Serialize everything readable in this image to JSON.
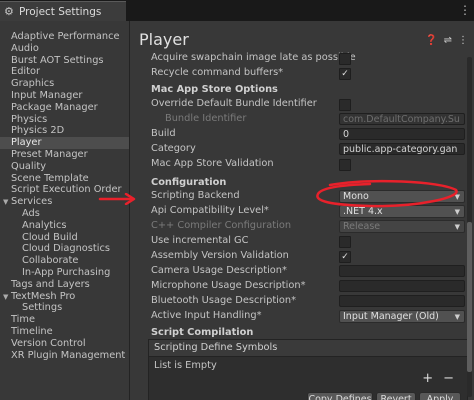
{
  "window": {
    "tab_label": "Project Settings",
    "menu_icon": "kebab-menu-icon"
  },
  "sidebar": {
    "items": [
      {
        "label": "Adaptive Performance",
        "level": 0
      },
      {
        "label": "Audio",
        "level": 0
      },
      {
        "label": "Burst AOT Settings",
        "level": 0
      },
      {
        "label": "Editor",
        "level": 0
      },
      {
        "label": "Graphics",
        "level": 0
      },
      {
        "label": "Input Manager",
        "level": 0
      },
      {
        "label": "Package Manager",
        "level": 0
      },
      {
        "label": "Physics",
        "level": 0
      },
      {
        "label": "Physics 2D",
        "level": 0
      },
      {
        "label": "Player",
        "level": 0,
        "selected": true
      },
      {
        "label": "Preset Manager",
        "level": 0
      },
      {
        "label": "Quality",
        "level": 0
      },
      {
        "label": "Scene Template",
        "level": 0
      },
      {
        "label": "Script Execution Order",
        "level": 0
      },
      {
        "label": "Services",
        "level": 0,
        "expanded": true
      },
      {
        "label": "Ads",
        "level": 1
      },
      {
        "label": "Analytics",
        "level": 1
      },
      {
        "label": "Cloud Build",
        "level": 1
      },
      {
        "label": "Cloud Diagnostics",
        "level": 1
      },
      {
        "label": "Collaborate",
        "level": 1
      },
      {
        "label": "In-App Purchasing",
        "level": 1
      },
      {
        "label": "Tags and Layers",
        "level": 0
      },
      {
        "label": "TextMesh Pro",
        "level": 0,
        "expanded": true
      },
      {
        "label": "Settings",
        "level": 1
      },
      {
        "label": "Time",
        "level": 0
      },
      {
        "label": "Timeline",
        "level": 0
      },
      {
        "label": "Version Control",
        "level": 0
      },
      {
        "label": "XR Plugin Management",
        "level": 0
      }
    ]
  },
  "main": {
    "title": "Player",
    "header_icons": [
      "help-icon",
      "preset-icon",
      "more-icon"
    ],
    "rows": {
      "acquire_swapchain": {
        "label": "Acquire swapchain image late as possible",
        "checked": false
      },
      "recycle_buffers": {
        "label": "Recycle command buffers*",
        "checked": true
      },
      "mac_app_store_section": "Mac App Store Options",
      "override_bundle": {
        "label": "Override Default Bundle Identifier",
        "checked": false
      },
      "bundle_identifier": {
        "label": "Bundle Identifier",
        "value": "com.DefaultCompany.Su"
      },
      "build": {
        "label": "Build",
        "value": "0"
      },
      "category": {
        "label": "Category",
        "value": "public.app-category.gan"
      },
      "mac_validation": {
        "label": "Mac App Store Validation",
        "checked": false
      },
      "configuration_section": "Configuration",
      "scripting_backend": {
        "label": "Scripting Backend",
        "value": "Mono"
      },
      "api_compat": {
        "label": "Api Compatibility Level*",
        "value": ".NET 4.x"
      },
      "cpp_compiler": {
        "label": "C++ Compiler Configuration",
        "value": "Release"
      },
      "incremental_gc": {
        "label": "Use incremental GC",
        "checked": false
      },
      "assembly_validation": {
        "label": "Assembly Version Validation",
        "checked": true
      },
      "camera_usage": {
        "label": "Camera Usage Description*",
        "value": ""
      },
      "microphone_usage": {
        "label": "Microphone Usage Description*",
        "value": ""
      },
      "bluetooth_usage": {
        "label": "Bluetooth Usage Description*",
        "value": ""
      },
      "active_input": {
        "label": "Active Input Handling*",
        "value": "Input Manager (Old)"
      },
      "script_compilation_section": "Script Compilation",
      "define_symbols_header": "Scripting Define Symbols",
      "define_symbols_empty": "List is Empty",
      "copy_defines": "Copy Defines",
      "revert": "Revert",
      "apply": "Apply"
    }
  },
  "annotation_colors": {
    "arrow": "#e8212b",
    "ellipse": "#e8212b"
  }
}
